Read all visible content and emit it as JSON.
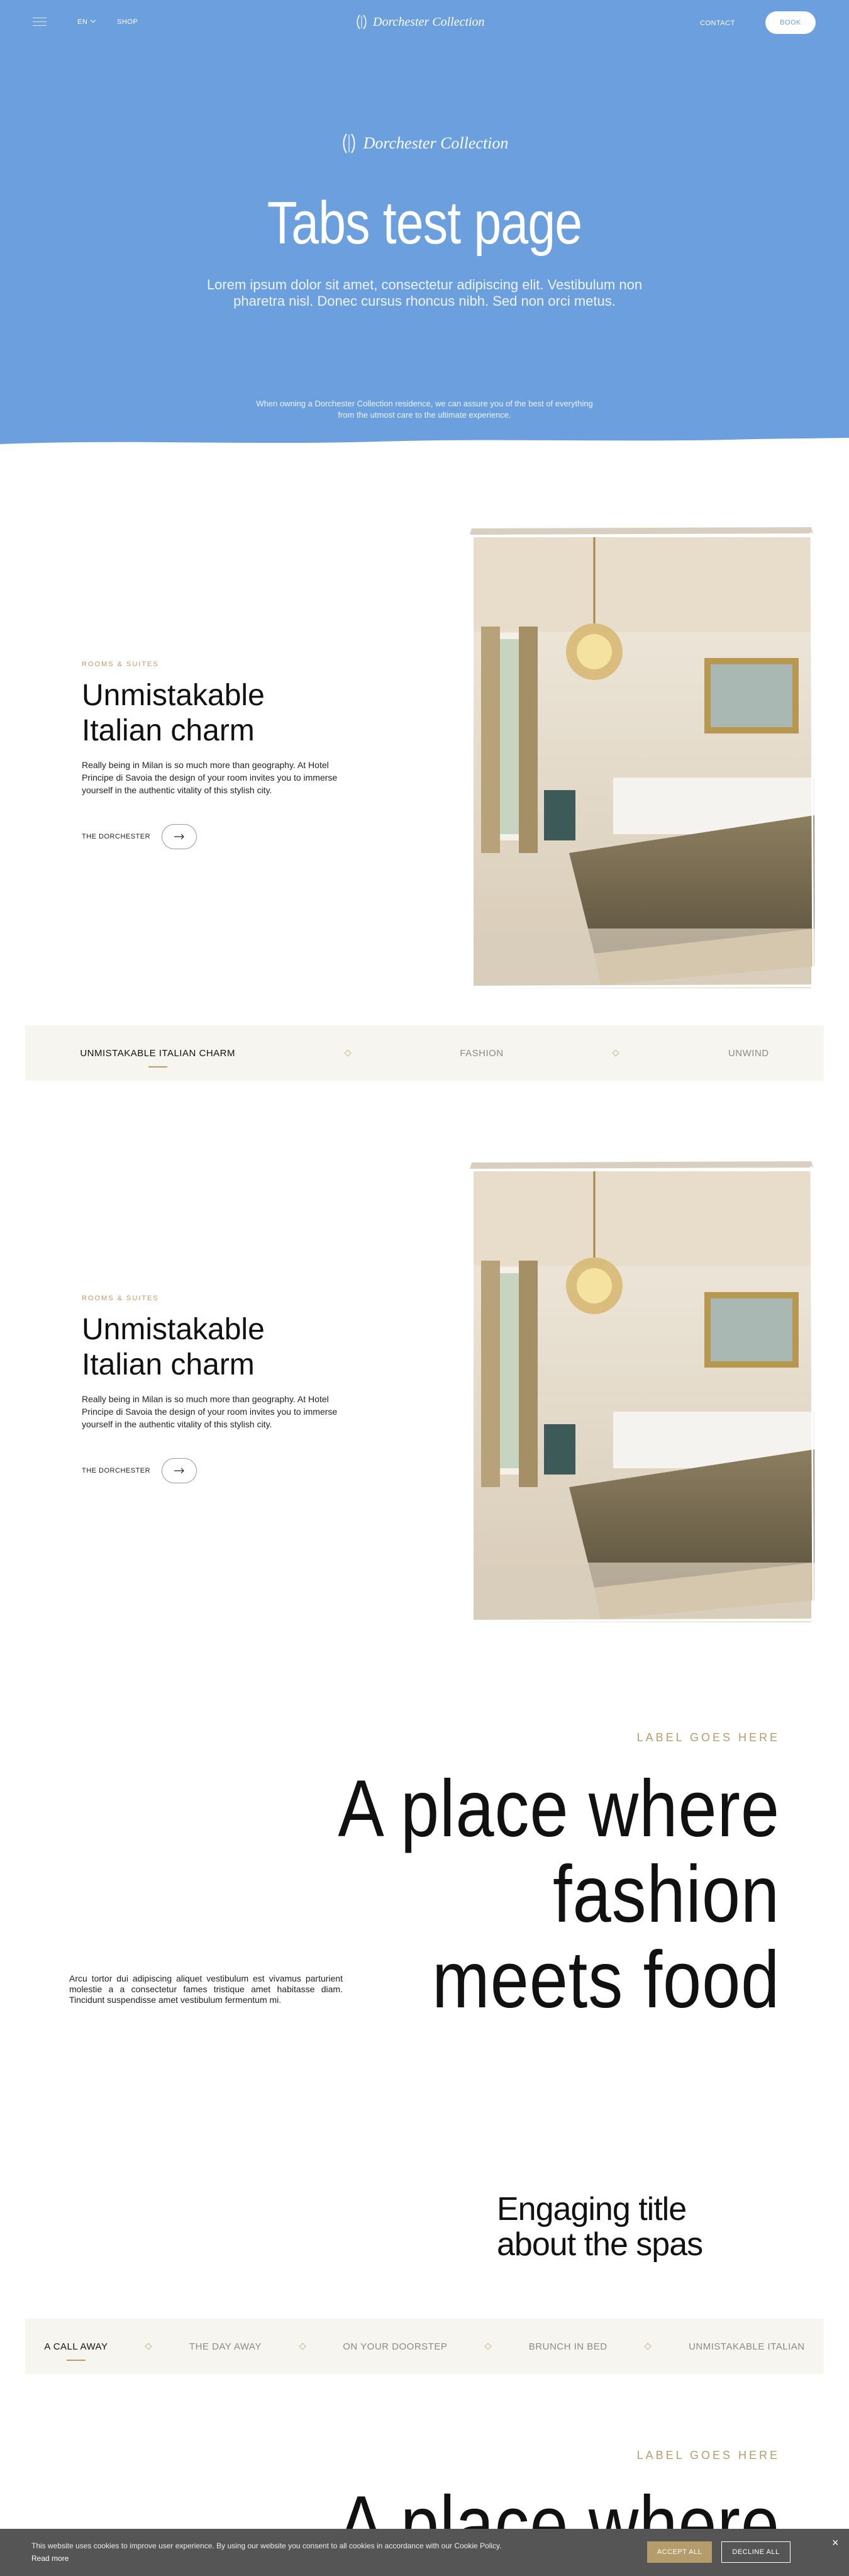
{
  "header": {
    "lang": "EN",
    "shop": "SHOP",
    "logo": "Dorchester Collection",
    "contact": "CONTACT",
    "book": "BOOK"
  },
  "hero": {
    "brand": "Dorchester Collection",
    "title": "Tabs test page",
    "subtitle": "Lorem ipsum dolor sit amet, consectetur adipiscing elit. Vestibulum non pharetra nisl. Donec cursus rhoncus nibh. Sed non orci metus.",
    "note": "When owning a Dorchester Collection residence, we can assure you of the best of everything from the utmost care to the ultimate experience."
  },
  "room1": {
    "eyebrow": "ROOMS & SUITES",
    "title_line1": "Unmistakable",
    "title_line2": "Italian charm",
    "text": "Really being in Milan is so much more than geography. At Hotel Principe di Savoia the design of your room invites you to immerse yourself in the authentic vitality of this stylish city.",
    "link": "THE DORCHESTER"
  },
  "tabs1": [
    "UNMISTAKABLE ITALIAN CHARM",
    "FASHION",
    "UNWIND"
  ],
  "room2": {
    "eyebrow": "ROOMS & SUITES",
    "title_line1": "Unmistakable",
    "title_line2": "Italian charm",
    "text": "Really being in Milan is so much more than geography. At Hotel Principe di Savoia the design of your room invites you to immerse yourself in the authentic vitality of this stylish city.",
    "link": "THE DORCHESTER"
  },
  "fashion": {
    "label": "LABEL GOES HERE",
    "title_line1": "A place where fashion",
    "title_line2": "meets food",
    "text": "Arcu tortor dui adipiscing aliquet vestibulum est vivamus parturient molestie a a consectetur fames tristique amet habitasse diam. Tincidunt suspendisse amet vestibulum fermentum mi."
  },
  "spa": {
    "title_line1": "Engaging title",
    "title_line2": "about the spas"
  },
  "tabs2": [
    "A CALL AWAY",
    "THE DAY AWAY",
    "ON YOUR DOORSTEP",
    "BRUNCH IN BED",
    "UNMISTAKABLE ITALIAN"
  ],
  "fashion2": {
    "label": "LABEL GOES HERE",
    "title_line1": "A place where fashion"
  },
  "cookie": {
    "text": "This website uses cookies to improve user experience. By using our website you consent to all cookies in accordance with our Cookie Policy.",
    "read_more": "Read more",
    "accept": "ACCEPT ALL",
    "decline": "DECLINE ALL",
    "close": "×"
  },
  "colors": {
    "hero_blue": "#6b9fdd",
    "gold": "#b59c6b",
    "tab_bg": "#f7f5ef"
  }
}
